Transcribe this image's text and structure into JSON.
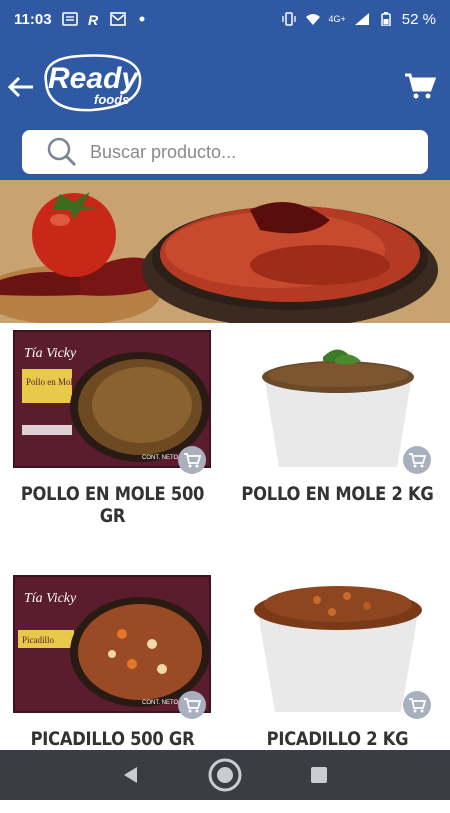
{
  "status": {
    "time": "11:03",
    "network": "4G+",
    "battery": "52 %"
  },
  "header": {
    "brand_top": "Ready",
    "brand_bottom": "foods"
  },
  "search": {
    "placeholder": "Buscar producto..."
  },
  "products": [
    {
      "name": "POLLO EN MOLE 500 GR"
    },
    {
      "name": "POLLO EN MOLE 2 KG"
    },
    {
      "name": "PICADILLO 500 GR"
    },
    {
      "name": "PICADILLO 2 KG"
    }
  ],
  "package": {
    "brand": "Tía Vicky",
    "label1": "Pollo en Mole",
    "label2": "Picadillo",
    "net": "CONT. NETO 500"
  },
  "icons": {
    "back": "arrow-left-icon",
    "cart": "cart-icon",
    "search": "search-icon",
    "add": "add-to-cart-icon"
  },
  "colors": {
    "brand_blue": "#2f5aa3",
    "nav_dark": "#3a3e44"
  }
}
